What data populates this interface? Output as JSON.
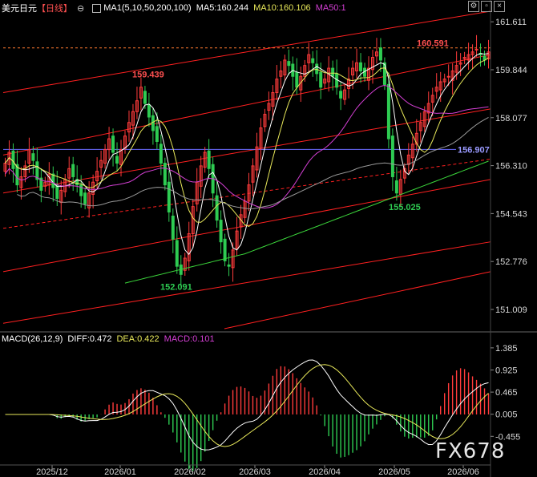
{
  "header": {
    "symbol": "美元日元",
    "period": "【日线】",
    "ma_text": "MA1(5,10,50,200,100)",
    "ma5": "MA5:160.244",
    "ma10": "MA10:160.106",
    "ma50": "MA50:1"
  },
  "macd_header": {
    "name": "MACD(26,12,9)",
    "diff": "DIFF:0.472",
    "dea": "DEA:0.422",
    "macd": "MACD:0.101"
  },
  "watermark": "FX678",
  "colors": {
    "up": "#ff3b3b",
    "down": "#2ecc52",
    "ma5": "#ffffff",
    "ma10": "#e8e85a",
    "ma50": "#d43fd4",
    "ma100": "#9a9a9a",
    "ma200": "#3bd63b",
    "channel": "#ff2020",
    "hline": "#6a6aff"
  },
  "chart_data": [
    {
      "type": "candlestick",
      "title": "美元日元【日线】",
      "ylim": [
        150.3,
        162.0
      ],
      "y_ticks": [
        "161.611",
        "159.844",
        "158.077",
        "156.310",
        "154.543",
        "152.776",
        "151.009"
      ],
      "x_ticks": [
        "2025/12",
        "2026/01",
        "2026/02",
        "2026/03",
        "2026/04",
        "2026/05",
        "2026/06"
      ],
      "annotations": [
        {
          "label": "159.439",
          "value": 159.439,
          "color": "#ff5050"
        },
        {
          "label": "152.091",
          "value": 152.091,
          "color": "#2ecc52"
        },
        {
          "label": "155.025",
          "value": 155.025,
          "color": "#2ecc52"
        },
        {
          "label": "160.591",
          "value": 160.591,
          "color": "#ff5050"
        }
      ],
      "horizontal_line": {
        "label": "156.907",
        "value": 156.907
      },
      "last_price_line": 160.65,
      "closes": [
        156.4,
        156.8,
        156.2,
        155.6,
        155.9,
        156.3,
        156.9,
        156.5,
        155.8,
        155.4,
        155.7,
        156.0,
        155.5,
        155.1,
        155.4,
        155.8,
        156.2,
        155.9,
        155.6,
        155.2,
        154.9,
        155.3,
        155.7,
        156.1,
        156.5,
        156.9,
        157.3,
        156.8,
        156.4,
        156.9,
        157.4,
        157.9,
        158.3,
        158.7,
        159.2,
        158.6,
        158.1,
        157.6,
        157.2,
        156.4,
        155.6,
        154.6,
        153.6,
        152.6,
        152.3,
        152.9,
        153.8,
        154.8,
        155.7,
        156.3,
        156.8,
        156.2,
        155.3,
        154.3,
        153.5,
        152.8,
        152.6,
        153.2,
        153.9,
        154.5,
        155.0,
        155.6,
        156.3,
        157.0,
        157.7,
        158.2,
        158.6,
        159.0,
        159.5,
        159.8,
        160.2,
        160.0,
        159.6,
        159.2,
        159.6,
        160.0,
        160.4,
        160.1,
        159.7,
        159.2,
        159.5,
        159.9,
        159.6,
        159.2,
        158.8,
        159.1,
        159.5,
        159.9,
        160.1,
        159.8,
        159.6,
        159.9,
        160.3,
        160.5,
        160.2,
        159.3,
        157.3,
        155.9,
        155.3,
        155.8,
        156.2,
        156.7,
        157.1,
        157.5,
        157.9,
        158.3,
        158.6,
        158.9,
        159.2,
        159.4,
        159.5,
        159.6,
        159.8,
        160.0,
        160.1,
        160.3,
        160.4,
        160.5,
        160.6,
        160.4,
        160.2,
        160.5
      ],
      "series": [
        {
          "name": "MA5",
          "color": "#ffffff"
        },
        {
          "name": "MA10",
          "color": "#e8e85a"
        },
        {
          "name": "MA50",
          "color": "#d43fd4"
        }
      ],
      "grid": false
    },
    {
      "type": "macd",
      "title": "MACD(26,12,9)",
      "ylim": [
        -1.05,
        1.45
      ],
      "y_ticks": [
        "1.385",
        "0.925",
        "0.465",
        "0.005",
        "-0.455"
      ],
      "series": [
        {
          "name": "DIFF",
          "value": 0.472
        },
        {
          "name": "DEA",
          "value": 0.422
        },
        {
          "name": "MACD",
          "value": 0.101
        }
      ]
    }
  ]
}
